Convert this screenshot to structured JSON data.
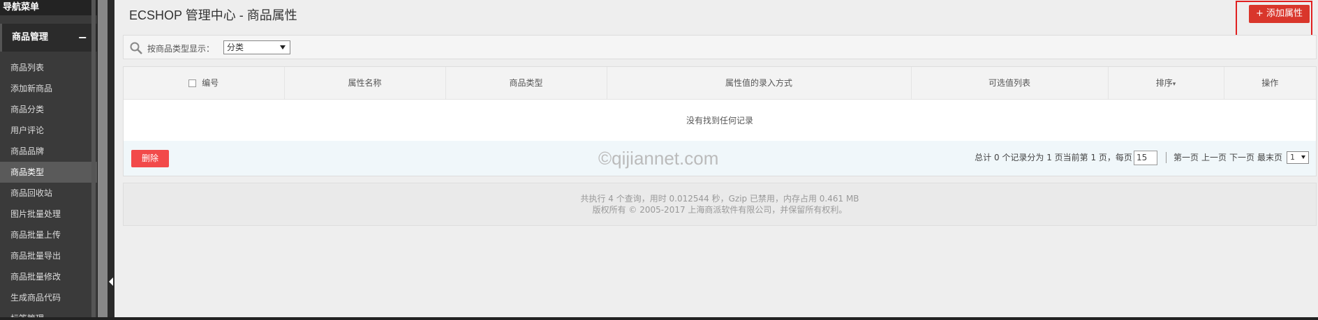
{
  "sidebar": {
    "title": "导航菜单",
    "section": "商品管理",
    "collapse_symbol": "−",
    "items": [
      {
        "label": "商品列表"
      },
      {
        "label": "添加新商品"
      },
      {
        "label": "商品分类"
      },
      {
        "label": "用户评论"
      },
      {
        "label": "商品品牌"
      },
      {
        "label": "商品类型"
      },
      {
        "label": "商品回收站"
      },
      {
        "label": "图片批量处理"
      },
      {
        "label": "商品批量上传"
      },
      {
        "label": "商品批量导出"
      },
      {
        "label": "商品批量修改"
      },
      {
        "label": "生成商品代码"
      },
      {
        "label": "标签管理"
      }
    ],
    "active_item": "商品类型"
  },
  "header": {
    "title": "ECSHOP 管理中心 - 商品属性",
    "add_button": "+ 添加属性"
  },
  "filter": {
    "label": "按商品类型显示：",
    "selected": "分类"
  },
  "table": {
    "columns": [
      "编号",
      "属性名称",
      "商品类型",
      "属性值的录入方式",
      "可选值列表",
      "排序",
      "操作"
    ],
    "sort_indicator": "▾",
    "empty_message": "没有找到任何记录"
  },
  "footer": {
    "delete_button": "删除",
    "watermark": "©qijiannet.com",
    "summary": "总计 0 个记录分为 1 页当前第 1 页，每页",
    "per_page": "15",
    "first": "第一页",
    "prev": "上一页",
    "next": "下一页",
    "last": "最末页",
    "page_select": "1"
  },
  "stats": {
    "line1": "共执行 4 个查询，用时 0.012544 秒，Gzip 已禁用，内存占用 0.461 MB",
    "line2": "版权所有 © 2005-2017 上海商派软件有限公司，并保留所有权利。"
  }
}
